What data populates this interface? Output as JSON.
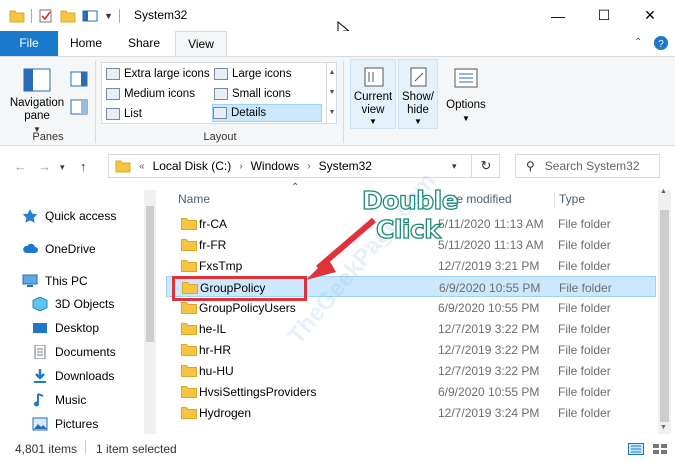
{
  "window": {
    "title": "System32",
    "minimize_glyph": "—",
    "maximize_glyph": "☐",
    "close_glyph": "✕"
  },
  "ribbon_tabs": [
    {
      "label": "File"
    },
    {
      "label": "Home"
    },
    {
      "label": "Share"
    },
    {
      "label": "View"
    }
  ],
  "ribbon": {
    "nav_pane_label": "Navigation pane",
    "panes_group": "Panes",
    "layout_group": "Layout",
    "layout_options": [
      {
        "label": "Extra large icons"
      },
      {
        "label": "Large icons"
      },
      {
        "label": "Medium icons"
      },
      {
        "label": "Small icons"
      },
      {
        "label": "List"
      },
      {
        "label": "Details"
      }
    ],
    "current_view_label": "Current view",
    "show_hide_label": "Show/ hide",
    "options_label": "Options"
  },
  "address": {
    "crumbs": [
      "Local Disk (C:)",
      "Windows",
      "System32"
    ],
    "search_placeholder": "Search System32"
  },
  "nav_pane": {
    "items": [
      {
        "label": "Quick access",
        "icon": "star-icon"
      },
      {
        "label": "OneDrive",
        "icon": "cloud-icon"
      },
      {
        "label": "This PC",
        "icon": "computer-icon"
      },
      {
        "label": "3D Objects",
        "icon": "cube-icon"
      },
      {
        "label": "Desktop",
        "icon": "desktop-icon"
      },
      {
        "label": "Documents",
        "icon": "document-icon"
      },
      {
        "label": "Downloads",
        "icon": "download-icon"
      },
      {
        "label": "Music",
        "icon": "music-icon"
      },
      {
        "label": "Pictures",
        "icon": "picture-icon"
      }
    ]
  },
  "file_list": {
    "columns": {
      "name": "Name",
      "date": "te modified",
      "type": "Type"
    },
    "rows": [
      {
        "name": "fr-CA",
        "date": "5/11/2020 11:13 AM",
        "type": "File folder"
      },
      {
        "name": "fr-FR",
        "date": "5/11/2020 11:13 AM",
        "type": "File folder"
      },
      {
        "name": "FxsTmp",
        "date": "12/7/2019 3:21 PM",
        "type": "File folder"
      },
      {
        "name": "GroupPolicy",
        "date": "6/9/2020 10:55 PM",
        "type": "File folder"
      },
      {
        "name": "GroupPolicyUsers",
        "date": "6/9/2020 10:55 PM",
        "type": "File folder"
      },
      {
        "name": "he-IL",
        "date": "12/7/2019 3:22 PM",
        "type": "File folder"
      },
      {
        "name": "hr-HR",
        "date": "12/7/2019 3:22 PM",
        "type": "File folder"
      },
      {
        "name": "hu-HU",
        "date": "12/7/2019 3:22 PM",
        "type": "File folder"
      },
      {
        "name": "HvsiSettingsProviders",
        "date": "6/9/2020 10:55 PM",
        "type": "File folder"
      },
      {
        "name": "Hydrogen",
        "date": "12/7/2019 3:24 PM",
        "type": "File folder"
      }
    ]
  },
  "status": {
    "item_count": "4,801 items",
    "selection": "1 item selected"
  },
  "annotation": {
    "line1": "Double",
    "line2": "Click",
    "watermark": "TheGeekPage.com"
  },
  "colors": {
    "accent": "#1979ca",
    "selection": "#cce8ff",
    "annotation_red": "#e0323a",
    "folder": "#f5c542"
  }
}
